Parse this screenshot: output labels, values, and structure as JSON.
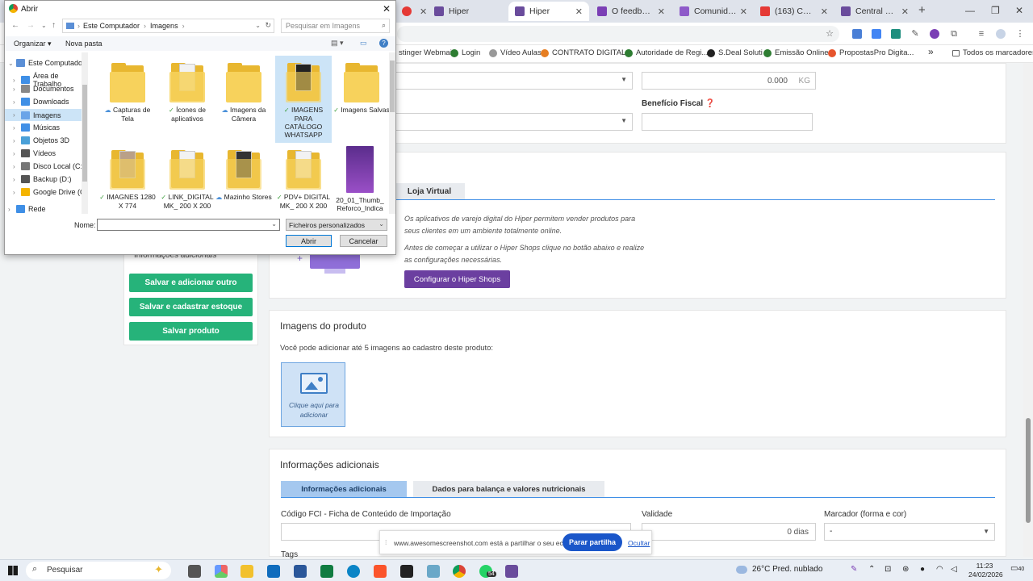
{
  "browser": {
    "tabs": [
      {
        "label": "",
        "color": "#e53935",
        "active": false
      },
      {
        "label": "Hiper",
        "color": "#6a4c9c",
        "active": false
      },
      {
        "label": "Hiper",
        "color": "#6a4c9c",
        "active": true
      },
      {
        "label": "O feedback qu",
        "color": "#7b3fb5",
        "active": false
      },
      {
        "label": "Comunidade d",
        "color": "#8e5ac9",
        "active": false
      },
      {
        "label": "(163) COMO U",
        "color": "#e53935",
        "active": false
      },
      {
        "label": "Central de Ate",
        "color": "#6a4c9c",
        "active": false
      }
    ],
    "new_tab": "+",
    "bookmarks": [
      {
        "label": "stinger Webmail",
        "color": "#888888"
      },
      {
        "label": "Login",
        "color": "#2e7d32"
      },
      {
        "label": "Vídeo Aulas",
        "color": "#777777"
      },
      {
        "label": "CONTRATO DIGITAL...",
        "color": "#e67e22"
      },
      {
        "label": "Autoridade de Regi...",
        "color": "#2e7d32"
      },
      {
        "label": "S.Deal Soluti",
        "color": "#222222"
      },
      {
        "label": "Emissão Online",
        "color": "#2e7d32"
      },
      {
        "label": "PropostasPro Digita...",
        "color": "#e6542d"
      }
    ],
    "bookmarks_more": "»",
    "all_bookmarks": "Todos os marcadores"
  },
  "page": {
    "weight_value": "0.000",
    "weight_unit": "KG",
    "beneficio_label": "Benefício Fiscal",
    "loja_tab": "Loja Virtual",
    "shops_text1": "Os aplicativos de varejo digital do Hiper permitem vender produtos para seus clientes em um ambiente totalmente online.",
    "shops_text2": "Antes de começar a utilizar o Hiper Shops clique no botão abaixo e realize as configurações necessárias.",
    "shops_button": "Configurar o Hiper Shops",
    "side_info": "Informações adicionais",
    "btn_save_add": "Salvar e adicionar outro",
    "btn_save_stock": "Salvar e cadastrar estoque",
    "btn_save": "Salvar produto",
    "images_title": "Imagens do produto",
    "images_desc": "Você pode adicionar até 5 imagens ao cadastro deste produto:",
    "images_add": "Clique aqui para adicionar",
    "info_title": "Informações adicionais",
    "info_tab1": "Informações adicionais",
    "info_tab2": "Dados para balança e valores nutricionais",
    "fci_label": "Código FCI - Ficha de Conteúdo de Importação",
    "validade_label": "Validade",
    "validade_value": "0 dias",
    "marcador_label": "Marcador (forma e cor)",
    "marcador_value": "-",
    "tags_label": "Tags"
  },
  "dialog": {
    "title": "Abrir",
    "breadcrumb": [
      "Este Computador",
      "Imagens"
    ],
    "search_placeholder": "Pesquisar em Imagens",
    "organize": "Organizar",
    "new_folder": "Nova pasta",
    "tree": [
      {
        "label": "Este Computador",
        "color": "#5b8fd6"
      },
      {
        "label": "Área de Trabalho",
        "color": "#3f8fe6"
      },
      {
        "label": "Documentos",
        "color": "#888888"
      },
      {
        "label": "Downloads",
        "color": "#3f8fe6"
      },
      {
        "label": "Imagens",
        "color": "#6aa4e8"
      },
      {
        "label": "Músicas",
        "color": "#3f8fe6"
      },
      {
        "label": "Objetos 3D",
        "color": "#4aa0d8"
      },
      {
        "label": "Vídeos",
        "color": "#555555"
      },
      {
        "label": "Disco Local (C:)",
        "color": "#777777"
      },
      {
        "label": "Backup (D:)",
        "color": "#555555"
      },
      {
        "label": "Google Drive (G:",
        "color": "#f4b400"
      },
      {
        "label": "Rede",
        "color": "#3f8fe6"
      }
    ],
    "folders": [
      {
        "label": "Capturas de Tela",
        "status": "☁"
      },
      {
        "label": "Ícones de aplicativos",
        "status": "✓"
      },
      {
        "label": "Imagens da Câmera",
        "status": "☁"
      },
      {
        "label": "IMAGENS PARA CATÁLOGO WHATSAPP",
        "status": "✓"
      },
      {
        "label": "Imagens Salvas",
        "status": "✓"
      },
      {
        "label": "IMAGNES 1280 X 774",
        "status": "✓"
      },
      {
        "label": "LINK_DIGITAL MK_ 200 X 200",
        "status": "✓"
      },
      {
        "label": "Mazinho Stores",
        "status": "☁"
      },
      {
        "label": "PDV+ DIGITAL MK_ 200 X 200",
        "status": "✓"
      },
      {
        "label": "20_01_Thumb_ Reforco_Indica",
        "status": ""
      }
    ],
    "name_label": "Nome:",
    "filter": "Ficheiros personalizados",
    "open_button": "Abrir",
    "cancel_button": "Cancelar"
  },
  "share_banner": {
    "text": "www.awesomescreenshot.com está a partilhar o seu ecrã.",
    "stop": "Parar partilha",
    "hide": "Ocultar"
  },
  "taskbar": {
    "search": "Pesquisar",
    "weather": "26°C  Pred. nublado",
    "time": "11:23",
    "date": "24/02/2026",
    "badge": "54",
    "notif": "40"
  }
}
